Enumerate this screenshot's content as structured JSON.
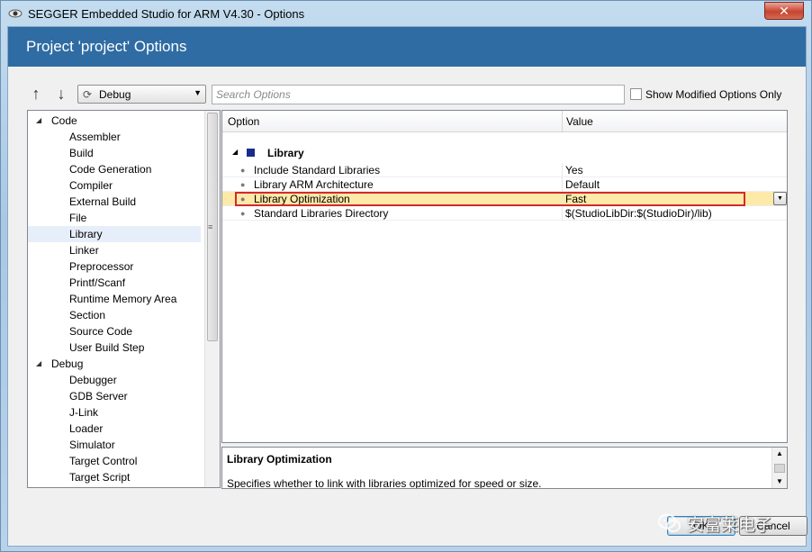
{
  "window": {
    "title": "SEGGER Embedded Studio for ARM V4.30 - Options",
    "close_glyph": "✕",
    "app_icon": "segger-eye-icon"
  },
  "dialog": {
    "heading": "Project 'project' Options"
  },
  "toolbar": {
    "up_arrow": "↑",
    "down_arrow": "↓",
    "config_icon": "gear-cycle-icon",
    "config_value": "Debug",
    "config_dropdown": "▼",
    "search_placeholder": "Search Options",
    "show_modified_label": "Show Modified Options Only"
  },
  "tree": {
    "expand_glyph": "◢",
    "selected": "Library",
    "groups": [
      {
        "label": "Code",
        "items": [
          "Assembler",
          "Build",
          "Code Generation",
          "Compiler",
          "External Build",
          "File",
          "Library",
          "Linker",
          "Preprocessor",
          "Printf/Scanf",
          "Runtime Memory Area",
          "Section",
          "Source Code",
          "User Build Step"
        ]
      },
      {
        "label": "Debug",
        "items": [
          "Debugger",
          "GDB Server",
          "J-Link",
          "Loader",
          "Simulator",
          "Target Control",
          "Target Script"
        ]
      }
    ],
    "scroll_grip": "≡"
  },
  "grid": {
    "columns": [
      "Option",
      "Value"
    ],
    "category": "Library",
    "category_expand": "◢",
    "bullet": "●",
    "dropdown_glyph": "▼",
    "rows": [
      {
        "option": "Include Standard Libraries",
        "value": "Yes"
      },
      {
        "option": "Library ARM Architecture",
        "value": "Default"
      },
      {
        "option": "Library Optimization",
        "value": "Fast"
      },
      {
        "option": "Standard Libraries Directory",
        "value": "$(StudioLibDir:$(StudioDir)/lib)"
      }
    ],
    "highlighted_row": 2,
    "highlight_color": "#fde9a8",
    "annotation_color": "#d42a2a"
  },
  "description": {
    "title": "Library Optimization",
    "text": "Specifies whether to link with libraries optimized for speed or size.",
    "scroll_up": "▲",
    "scroll_down": "▼"
  },
  "buttons": {
    "ok": "OK",
    "cancel": "Cancel"
  },
  "watermark": {
    "text": "安富莱电子",
    "icon": "wechat-icon"
  },
  "colors": {
    "header_band": "#2f6ca3",
    "category_square": "#1a2c8a"
  }
}
